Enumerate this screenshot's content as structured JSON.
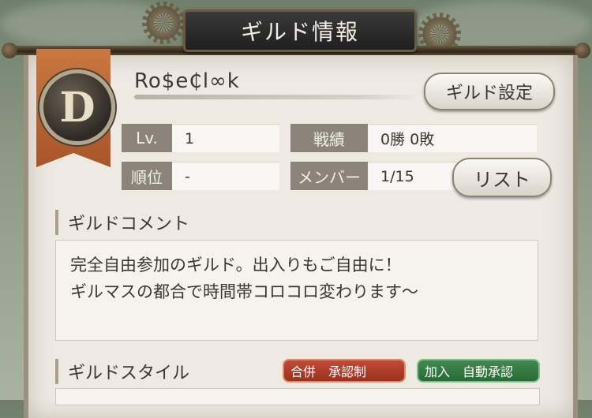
{
  "header": {
    "title": "ギルド情報"
  },
  "guild": {
    "rank_letter": "D",
    "name": "Ro$e₵l∞k",
    "settings_button": "ギルド設定",
    "list_button": "リスト"
  },
  "fields": {
    "level_label": "Lv.",
    "level_value": "1",
    "record_label": "戦績",
    "record_value": "0勝 0敗",
    "rank_label": "順位",
    "rank_value": "-",
    "members_label": "メンバー",
    "members_value": "1/15"
  },
  "comment": {
    "heading": "ギルドコメント",
    "line1": "完全自由参加のギルド。出入りもご自由に！",
    "line2": "ギルマスの都合で時間帯コロコロ変わります～"
  },
  "style": {
    "heading": "ギルドスタイル",
    "merge_label": "合併",
    "merge_value": "承認制",
    "join_label": "加入",
    "join_value": "自動承認"
  },
  "colors": {
    "banner": "#b5602f",
    "merge_tag": "#a8392a",
    "join_tag": "#327a42"
  },
  "icons": [
    "gear-icon",
    "rank-emblem"
  ]
}
